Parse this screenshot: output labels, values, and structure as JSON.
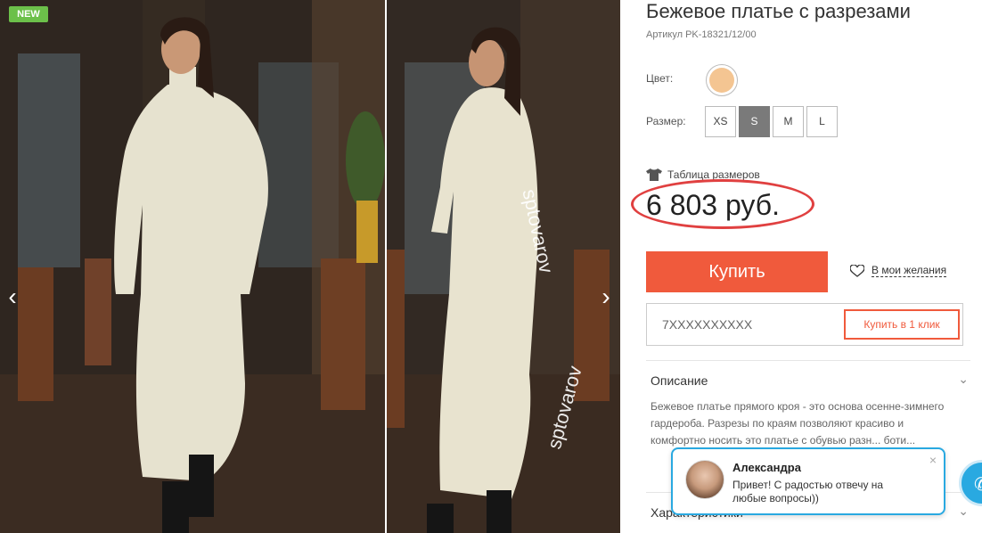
{
  "gallery": {
    "badge": "NEW",
    "prev_arrow": "‹",
    "next_arrow": "›",
    "watermark": "sptovarov"
  },
  "product": {
    "title": "Бежевое платье с разрезами",
    "sku": "Артикул PK-18321/12/00",
    "color_label": "Цвет:",
    "color_value": "#f4c592",
    "size_label": "Размер:",
    "sizes": [
      "XS",
      "S",
      "M",
      "L"
    ],
    "selected_size": "S",
    "size_table_label": "Таблица размеров",
    "price": "6 803 руб."
  },
  "actions": {
    "buy_label": "Купить",
    "wishlist_label": "В мои желания",
    "phone_placeholder": "7XXXXXXXXXX",
    "one_click_label": "Купить в 1 клик"
  },
  "description": {
    "title": "Описание",
    "text": "Бежевое платье прямого кроя - это основа осенне-зимнего гардероба. Разрезы по краям позволяют красиво и комфортно носить это платье с обувью разн... боти..."
  },
  "characteristics": {
    "title": "Характеристики"
  },
  "chat": {
    "name": "Александра",
    "message": "Привет! С радостью отвечу на любые вопросы))",
    "close": "×"
  },
  "colors": {
    "accent": "#f05a3c",
    "new_badge": "#6cc04a",
    "chat_border": "#29a9e1",
    "price_ring": "#e04040"
  }
}
